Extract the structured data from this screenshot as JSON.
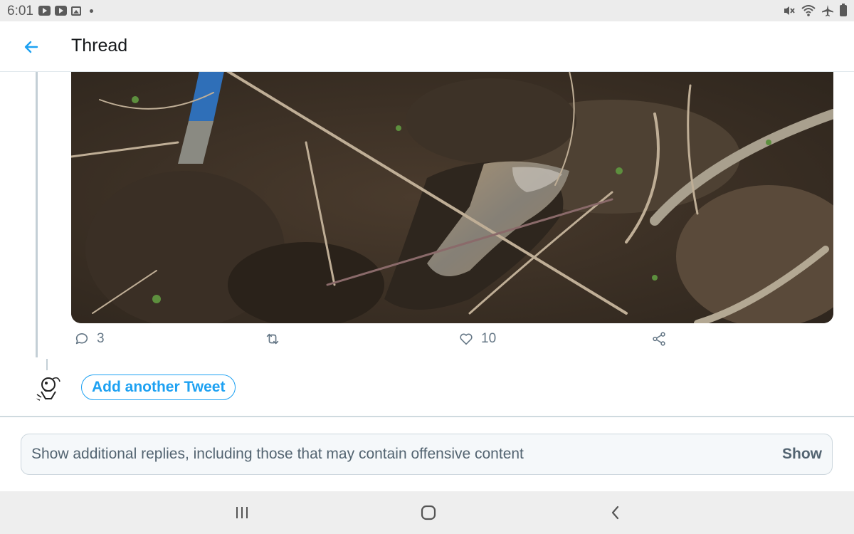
{
  "status_bar": {
    "time": "6:01",
    "left_icons": [
      "youtube-icon",
      "youtube-icon",
      "gallery-icon",
      "dot"
    ],
    "right_icons": [
      "mute-icon",
      "wifi-icon",
      "airplane-icon",
      "battery-icon"
    ]
  },
  "header": {
    "title": "Thread",
    "back_icon": "arrow-left-icon",
    "accent_color": "#1da1f2"
  },
  "tweet": {
    "image_icon": "photo",
    "replies_count": "3",
    "retweets_count": "",
    "likes_count": "10",
    "action_icons": [
      "reply-icon",
      "retweet-icon",
      "like-icon",
      "share-icon"
    ]
  },
  "composer": {
    "add_tweet_label": "Add another Tweet"
  },
  "more_replies": {
    "text": "Show additional replies, including those that may contain offensive content",
    "show_label": "Show"
  },
  "nav_bar": {
    "icons": [
      "recent-apps-icon",
      "home-icon",
      "back-icon"
    ]
  }
}
